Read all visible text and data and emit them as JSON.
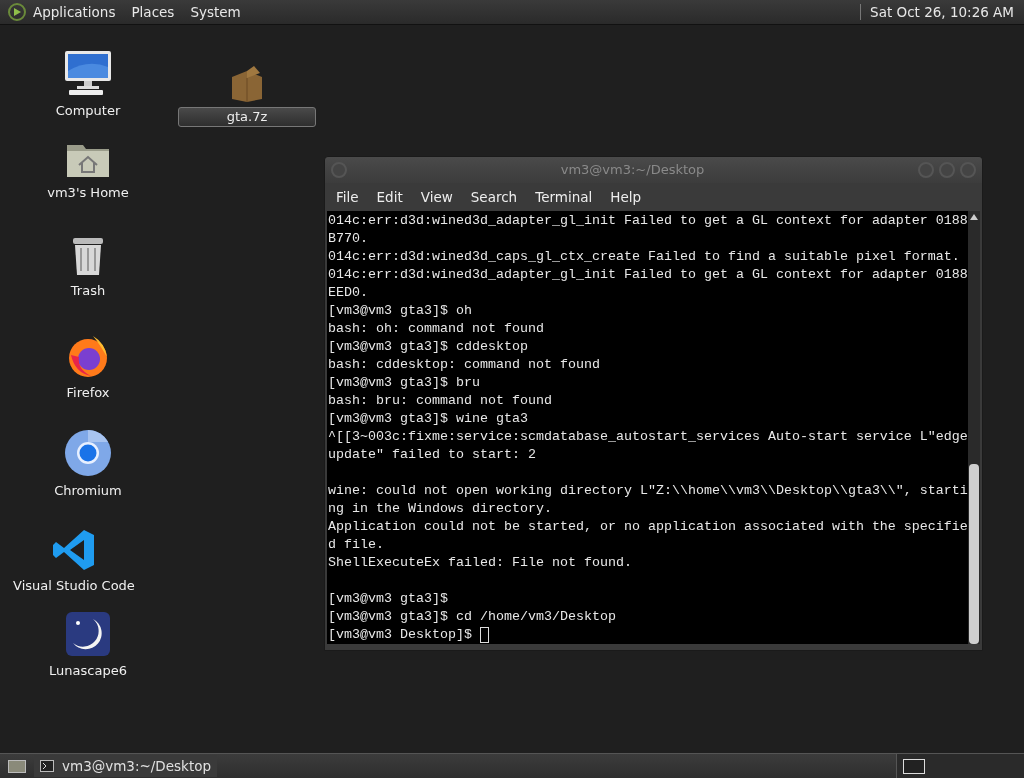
{
  "top_panel": {
    "menus": [
      "Applications",
      "Places",
      "System"
    ],
    "clock": "Sat Oct 26, 10:26 AM"
  },
  "desktop_icons": [
    {
      "kind": "computer",
      "label": "Computer",
      "editing": false
    },
    {
      "kind": "home",
      "label": "vm3's Home",
      "editing": false
    },
    {
      "kind": "trash",
      "label": "Trash",
      "editing": false
    },
    {
      "kind": "firefox",
      "label": "Firefox",
      "editing": false
    },
    {
      "kind": "chromium",
      "label": "Chromium",
      "editing": false
    },
    {
      "kind": "vscode",
      "label": "Visual Studio Code",
      "editing": false
    },
    {
      "kind": "lunascape",
      "label": "Lunascape6",
      "editing": false
    },
    {
      "kind": "archive",
      "label": "gta.7z",
      "editing": true
    }
  ],
  "terminal": {
    "title": "vm3@vm3:~/Desktop",
    "menu": [
      "File",
      "Edit",
      "View",
      "Search",
      "Terminal",
      "Help"
    ],
    "blocks": [
      [
        "014c:err:d3d:wined3d_adapter_gl_init Failed to get a GL context for adapter 0188",
        "B770.",
        "014c:err:d3d:wined3d_caps_gl_ctx_create Failed to find a suitable pixel format.",
        "014c:err:d3d:wined3d_adapter_gl_init Failed to get a GL context for adapter 0188",
        "EED0.",
        "[vm3@vm3 gta3]$ oh",
        "bash: oh: command not found",
        "[vm3@vm3 gta3]$ cddesktop",
        "bash: cddesktop: command not found",
        "[vm3@vm3 gta3]$ bru",
        "bash: bru: command not found",
        "[vm3@vm3 gta3]$ wine gta3",
        "^[[3~003c:fixme:service:scmdatabase_autostart_services Auto-start service L\"edge",
        "update\" failed to start: 2"
      ],
      [
        "wine: could not open working directory L\"Z:\\\\home\\\\vm3\\\\Desktop\\\\gta3\\\\\", starti",
        "ng in the Windows directory.",
        "Application could not be started, or no application associated with the specifie",
        "d file.",
        "ShellExecuteEx failed: File not found."
      ],
      [
        "[vm3@vm3 gta3]$",
        "[vm3@vm3 gta3]$ cd /home/vm3/Desktop",
        "[vm3@vm3 Desktop]$ "
      ]
    ],
    "cursor": true
  },
  "taskbar": {
    "tasks": [
      {
        "label": "vm3@vm3:~/Desktop",
        "selected": false
      }
    ]
  }
}
